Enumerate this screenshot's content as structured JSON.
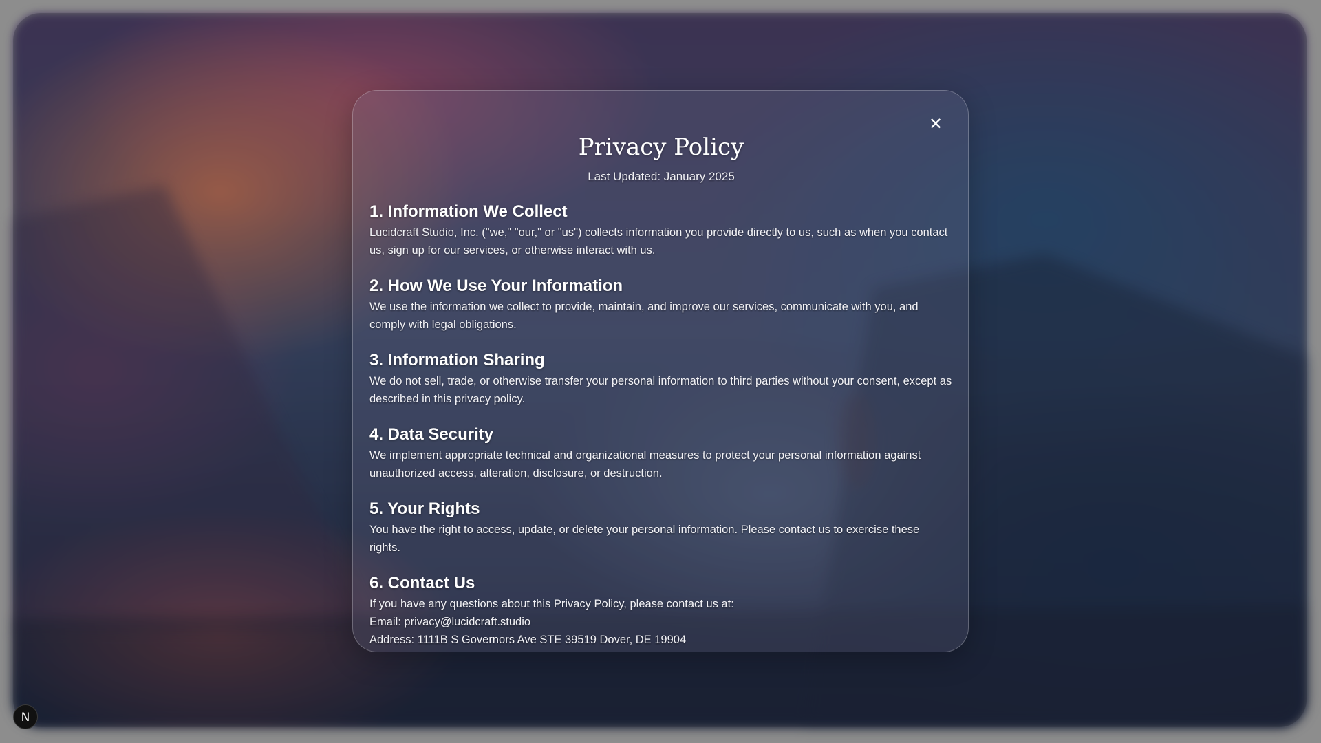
{
  "modal": {
    "close_icon": "close-icon",
    "close_glyph": "✕",
    "title": "Privacy Policy",
    "last_updated": "Last Updated: January 2025",
    "sections": [
      {
        "heading": "1. Information We Collect",
        "body": "Lucidcraft Studio, Inc. (\"we,\" \"our,\" or \"us\") collects information you provide directly to us, such as when you contact us, sign up for our services, or otherwise interact with us."
      },
      {
        "heading": "2. How We Use Your Information",
        "body": "We use the information we collect to provide, maintain, and improve our services, communicate with you, and comply with legal obligations."
      },
      {
        "heading": "3. Information Sharing",
        "body": "We do not sell, trade, or otherwise transfer your personal information to third parties without your consent, except as described in this privacy policy."
      },
      {
        "heading": "4. Data Security",
        "body": "We implement appropriate technical and organizational measures to protect your personal information against unauthorized access, alteration, disclosure, or destruction."
      },
      {
        "heading": "5. Your Rights",
        "body": "You have the right to access, update, or delete your personal information. Please contact us to exercise these rights."
      },
      {
        "heading": "6. Contact Us",
        "body": "If you have any questions about this Privacy Policy, please contact us at:",
        "email": "Email: privacy@lucidcraft.studio",
        "address": "Address: 1111B S Governors Ave STE 39519 Dover, DE 19904"
      }
    ]
  },
  "dev_badge": {
    "label": "N",
    "color": "#111111"
  }
}
